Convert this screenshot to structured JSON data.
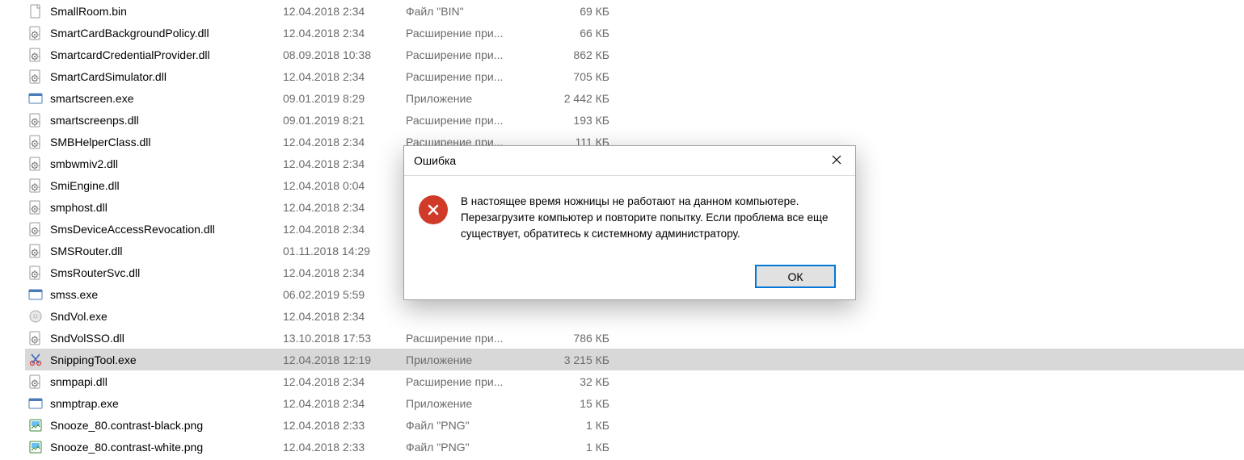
{
  "filelist": {
    "rows": [
      {
        "name": "SmallRoom.bin",
        "date": "12.04.2018 2:34",
        "type": "Файл \"BIN\"",
        "size": "69 КБ",
        "icon": "doc",
        "selected": false
      },
      {
        "name": "SmartCardBackgroundPolicy.dll",
        "date": "12.04.2018 2:34",
        "type": "Расширение при...",
        "size": "66 КБ",
        "icon": "gear",
        "selected": false
      },
      {
        "name": "SmartcardCredentialProvider.dll",
        "date": "08.09.2018 10:38",
        "type": "Расширение при...",
        "size": "862 КБ",
        "icon": "gear",
        "selected": false
      },
      {
        "name": "SmartCardSimulator.dll",
        "date": "12.04.2018 2:34",
        "type": "Расширение при...",
        "size": "705 КБ",
        "icon": "gear",
        "selected": false
      },
      {
        "name": "smartscreen.exe",
        "date": "09.01.2019 8:29",
        "type": "Приложение",
        "size": "2 442 КБ",
        "icon": "app",
        "selected": false
      },
      {
        "name": "smartscreenps.dll",
        "date": "09.01.2019 8:21",
        "type": "Расширение при...",
        "size": "193 КБ",
        "icon": "gear",
        "selected": false
      },
      {
        "name": "SMBHelperClass.dll",
        "date": "12.04.2018 2:34",
        "type": "Расширение при...",
        "size": "111 КБ",
        "icon": "gear",
        "selected": false
      },
      {
        "name": "smbwmiv2.dll",
        "date": "12.04.2018 2:34",
        "type": "",
        "size": "",
        "icon": "gear",
        "selected": false
      },
      {
        "name": "SmiEngine.dll",
        "date": "12.04.2018 0:04",
        "type": "",
        "size": "",
        "icon": "gear",
        "selected": false
      },
      {
        "name": "smphost.dll",
        "date": "12.04.2018 2:34",
        "type": "",
        "size": "",
        "icon": "gear",
        "selected": false
      },
      {
        "name": "SmsDeviceAccessRevocation.dll",
        "date": "12.04.2018 2:34",
        "type": "",
        "size": "",
        "icon": "gear",
        "selected": false
      },
      {
        "name": "SMSRouter.dll",
        "date": "01.11.2018 14:29",
        "type": "",
        "size": "",
        "icon": "gear",
        "selected": false
      },
      {
        "name": "SmsRouterSvc.dll",
        "date": "12.04.2018 2:34",
        "type": "",
        "size": "",
        "icon": "gear",
        "selected": false
      },
      {
        "name": "smss.exe",
        "date": "06.02.2019 5:59",
        "type": "",
        "size": "",
        "icon": "app",
        "selected": false
      },
      {
        "name": "SndVol.exe",
        "date": "12.04.2018 2:34",
        "type": "",
        "size": "",
        "icon": "disc",
        "selected": false
      },
      {
        "name": "SndVolSSO.dll",
        "date": "13.10.2018 17:53",
        "type": "Расширение при...",
        "size": "786 КБ",
        "icon": "gear",
        "selected": false
      },
      {
        "name": "SnippingTool.exe",
        "date": "12.04.2018 12:19",
        "type": "Приложение",
        "size": "3 215 КБ",
        "icon": "snip",
        "selected": true
      },
      {
        "name": "snmpapi.dll",
        "date": "12.04.2018 2:34",
        "type": "Расширение при...",
        "size": "32 КБ",
        "icon": "gear",
        "selected": false
      },
      {
        "name": "snmptrap.exe",
        "date": "12.04.2018 2:34",
        "type": "Приложение",
        "size": "15 КБ",
        "icon": "app",
        "selected": false
      },
      {
        "name": "Snooze_80.contrast-black.png",
        "date": "12.04.2018 2:33",
        "type": "Файл \"PNG\"",
        "size": "1 КБ",
        "icon": "png",
        "selected": false
      },
      {
        "name": "Snooze_80.contrast-white.png",
        "date": "12.04.2018 2:33",
        "type": "Файл \"PNG\"",
        "size": "1 КБ",
        "icon": "png",
        "selected": false
      }
    ]
  },
  "dialog": {
    "title": "Ошибка",
    "message": "В настоящее время ножницы не работают на данном компьютере. Перезагрузите компьютер и повторите попытку. Если проблема все еще существует, обратитесь к системному администратору.",
    "ok_label": "ОК"
  }
}
